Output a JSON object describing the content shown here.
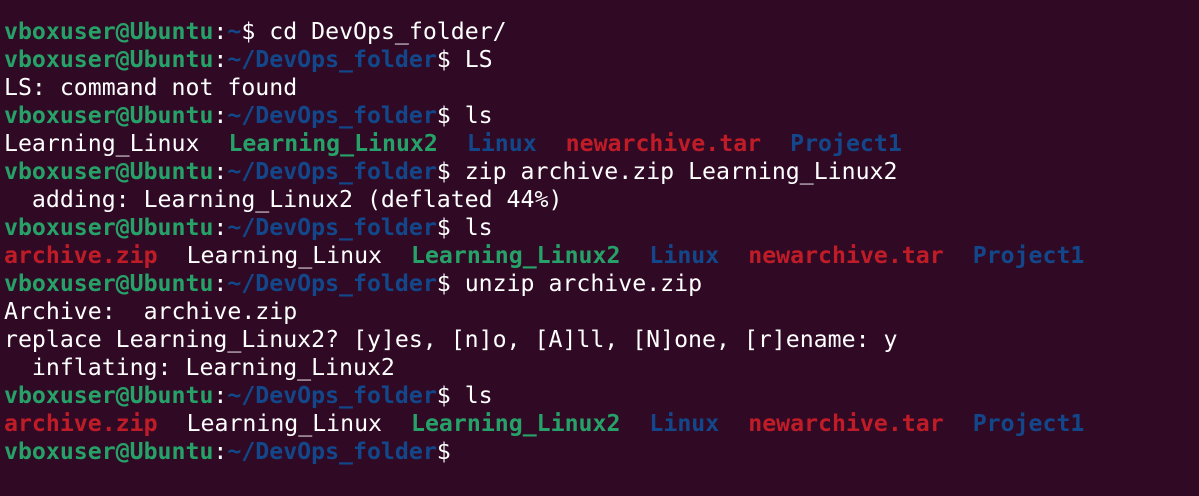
{
  "colors": {
    "background": "#300a24",
    "user_host": "#26a269",
    "path": "#12488b",
    "text": "#ffffff",
    "archive": "#c01c28",
    "dir_other_writable": "#26a269"
  },
  "prompt": {
    "user_host": "vboxuser@Ubuntu",
    "separator": ":",
    "home_path": "~",
    "folder_path": "~/DevOps_folder",
    "symbol": "$"
  },
  "lines": {
    "cmd1": " cd DevOps_folder/",
    "cmd2": " LS",
    "out2": "LS: command not found",
    "cmd3": " ls",
    "ls1": [
      "Learning_Linux",
      "Learning_Linux2",
      "Linux",
      "newarchive.tar",
      "Project1"
    ],
    "cmd4": " zip archive.zip Learning_Linux2",
    "out4": "  adding: Learning_Linux2 (deflated 44%)",
    "cmd5": " ls",
    "ls2": [
      "archive.zip",
      "Learning_Linux",
      "Learning_Linux2",
      "Linux",
      "newarchive.tar",
      "Project1"
    ],
    "cmd6": " unzip archive.zip",
    "out6a": "Archive:  archive.zip",
    "out6b": "replace Learning_Linux2? [y]es, [n]o, [A]ll, [N]one, [r]ename: y",
    "out6c": "  inflating: Learning_Linux2",
    "cmd7": " ls",
    "ls3": [
      "archive.zip",
      "Learning_Linux",
      "Learning_Linux2",
      "Linux",
      "newarchive.tar",
      "Project1"
    ],
    "cmd8": ""
  }
}
